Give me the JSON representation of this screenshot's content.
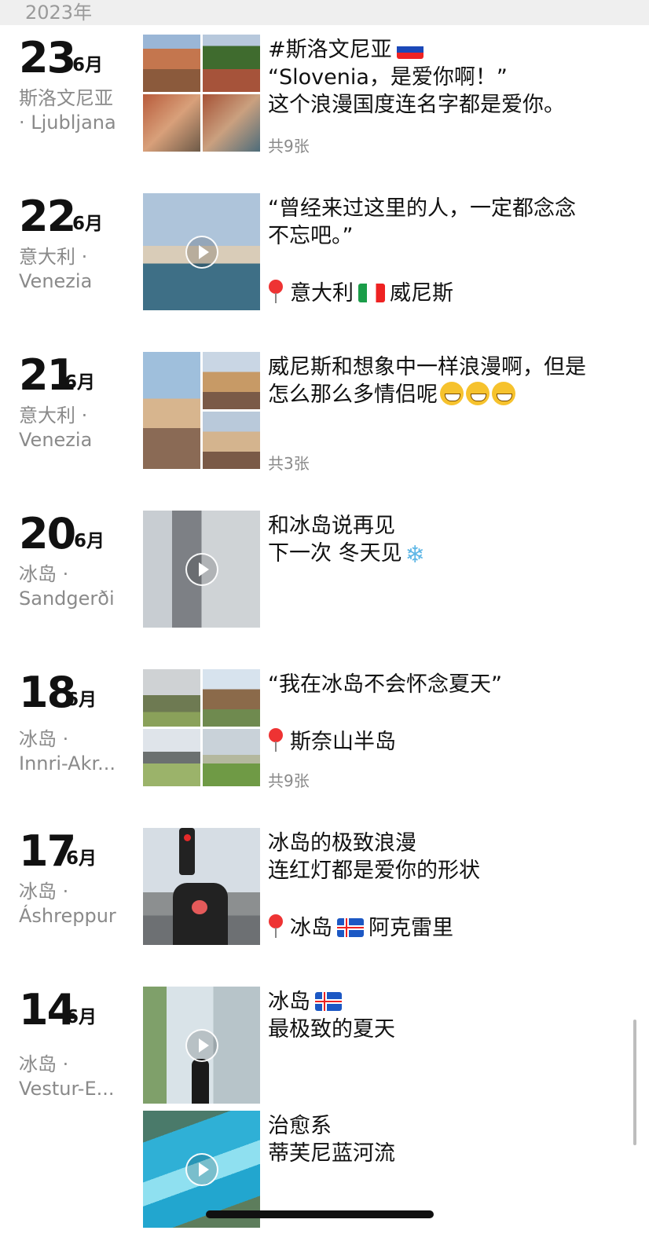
{
  "year_label": "2023年",
  "entries": [
    {
      "day": "23",
      "month": "6月",
      "loc1": "斯洛文尼亚",
      "loc2": "· Ljubljana",
      "lines": [
        "#斯洛文尼亚",
        "“Slovenia，是爱你啊！”",
        "这个浪漫国度连名字都是爱你。"
      ],
      "count": "共9张"
    },
    {
      "day": "22",
      "month": "6月",
      "loc1": "意大利 ·",
      "loc2": "Venezia",
      "lines": [
        "“曾经来过这里的人，一定都念念",
        "不忘吧。”"
      ],
      "place_before": "意大利",
      "place_after": "威尼斯"
    },
    {
      "day": "21",
      "month": "6月",
      "loc1": "意大利 ·",
      "loc2": "Venezia",
      "lines": [
        "威尼斯和想象中一样浪漫啊，但是",
        "怎么那么多情侣呢"
      ],
      "count": "共3张"
    },
    {
      "day": "20",
      "month": "6月",
      "loc1": "冰岛 ·",
      "loc2": "Sandgerði",
      "lines": [
        "和冰岛说再见",
        "下一次 冬天见"
      ]
    },
    {
      "day": "18",
      "month": "6月",
      "loc1": "冰岛 ·",
      "loc2": "Innri-Akr...",
      "lines": [
        "“我在冰岛不会怀念夏天”"
      ],
      "place_before": "斯奈山半岛",
      "count": "共9张"
    },
    {
      "day": "17",
      "month": "6月",
      "loc1": "冰岛 ·",
      "loc2": "Áshreppur",
      "lines": [
        "冰岛的极致浪漫",
        "连红灯都是爱你的形状"
      ],
      "place_before": "冰岛",
      "place_after": "阿克雷里"
    },
    {
      "day": "14",
      "month": "6月",
      "loc1": "冰岛 ·",
      "loc2": "Vestur-E...",
      "lines": [
        "冰岛",
        "最极致的夏天"
      ],
      "lines_b": [
        "治愈系",
        "蒂芙尼蓝河流"
      ]
    }
  ]
}
